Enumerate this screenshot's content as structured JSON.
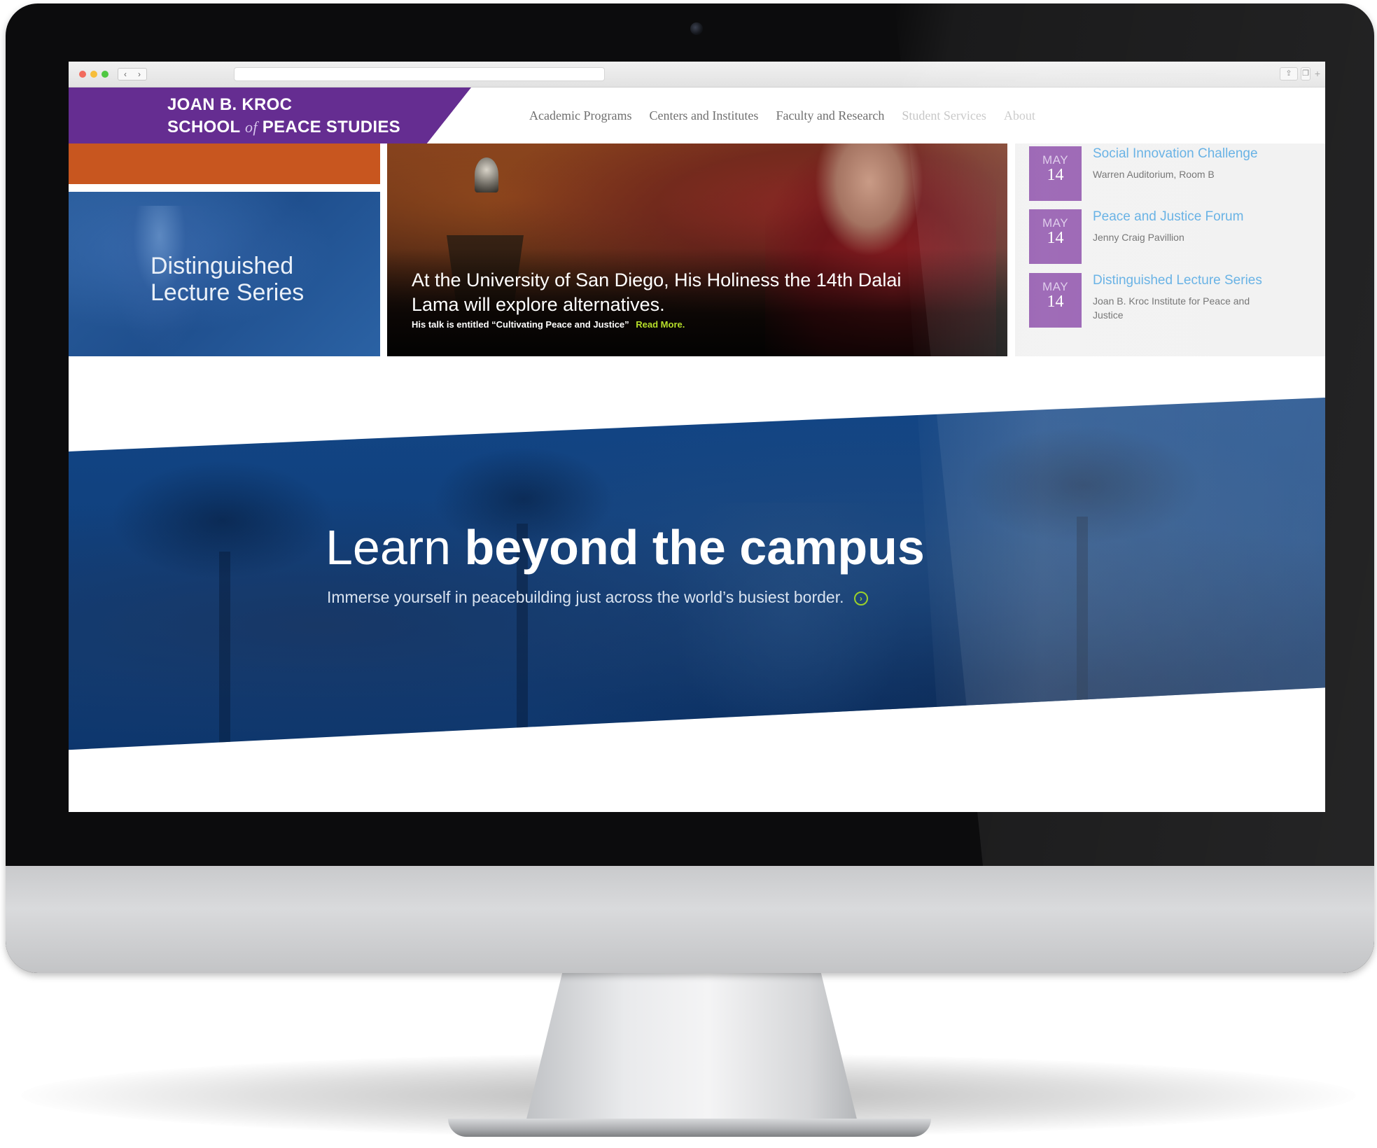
{
  "header": {
    "logo_line1": "JOAN B. KROC",
    "logo_line2_left": "SCHOOL",
    "logo_line2_of": "of",
    "logo_line2_right": "PEACE STUDIES",
    "nav": [
      "Academic Programs",
      "Centers and Institutes",
      "Faculty and Research",
      "Student Services",
      "About"
    ]
  },
  "feature": {
    "lecture_title": "Distinguished Lecture Series",
    "hero_headline": "At the University of San Diego, His Holiness the 14th Dalai Lama will explore alternatives.",
    "hero_sub": "His talk is entitled “Cultivating Peace and Justice”",
    "hero_readmore": "Read More."
  },
  "events": [
    {
      "month": "MAY",
      "day": "14",
      "title": "Social Innovation Challenge",
      "location": "Warren Auditorium, Room B"
    },
    {
      "month": "MAY",
      "day": "14",
      "title": "Peace and Justice Forum",
      "location": "Jenny Craig Pavillion"
    },
    {
      "month": "MAY",
      "day": "14",
      "title": "Distinguished Lecture Series",
      "location": "Joan B. Kroc Institute for Peace and Justice"
    }
  ],
  "banner": {
    "title_light": "Learn",
    "title_bold": "beyond the campus",
    "subtitle": "Immerse yourself in peacebuilding just across the world’s busiest border."
  },
  "colors": {
    "brand_purple": "#652d91",
    "accent_orange": "#c8561f",
    "banner_blue": "#0f3d78",
    "event_link_blue": "#4aa3e0",
    "readmore_green": "#b7e02a"
  },
  "icons": {
    "banner_link": "arrow-circle-right-icon",
    "browser_share": "share-icon",
    "browser_tabs": "tabs-icon"
  }
}
